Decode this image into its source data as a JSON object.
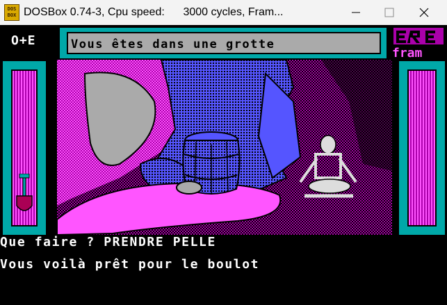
{
  "window": {
    "title": "DOSBox 0.74-3, Cpu speed:      3000 cycles, Fram...",
    "icon": "dosbox-icon",
    "icon_text": "DOS BOX",
    "controls": [
      "minimize",
      "maximize",
      "close"
    ]
  },
  "game": {
    "inventory_label": "O+E",
    "location_message": "Vous êtes dans une grotte",
    "logo_text": "ERE fram",
    "prompt_line": "Que faire ? PRENDRE PELLE",
    "response_line": "Vous voilà prêt pour le boulot",
    "held_item": "shovel-icon"
  },
  "colors": {
    "cyan": "#00a8a8",
    "magenta": "#aa00aa",
    "pink": "#ff55ff",
    "grey": "#aaaaaa",
    "blue": "#5555ff",
    "titlebar": "#f3f3f3"
  }
}
